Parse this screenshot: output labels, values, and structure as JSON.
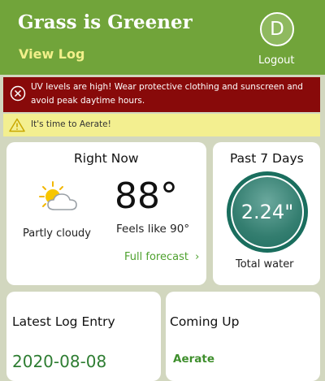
{
  "header": {
    "title": "Grass is Greener",
    "view_log_label": "View Log",
    "avatar_initial": "D",
    "logout_label": "Logout"
  },
  "alerts": {
    "uv": {
      "message": "UV levels are high! Wear protective clothing and sunscreen and avoid peak daytime hours.",
      "icon": "close-circle-icon",
      "color": "#880a0a"
    },
    "aerate": {
      "message": "It's time to Aerate!",
      "icon": "warning-icon",
      "color": "#f3ef90"
    }
  },
  "right_now": {
    "title": "Right Now",
    "weather_icon": "partly-cloudy-icon",
    "condition": "Partly cloudy",
    "temperature": "88°",
    "feels_like": "Feels like 90°",
    "forecast_link": "Full forecast",
    "forecast_chevron": "›"
  },
  "past_7_days": {
    "title": "Past 7 Days",
    "water_amount": "2.24\"",
    "water_label": "Total water"
  },
  "latest_log": {
    "title": "Latest Log Entry",
    "date": "2020-08-08"
  },
  "coming_up": {
    "title": "Coming Up",
    "item": "Aerate"
  },
  "colors": {
    "header_green": "#71a43a",
    "link_yellow": "#f2f08a",
    "link_green": "#4ea12e",
    "ring_teal": "#1a6e5e"
  }
}
